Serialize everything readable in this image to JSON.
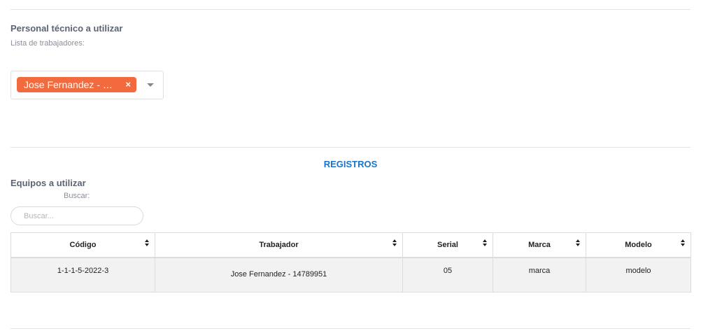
{
  "personal": {
    "title": "Personal técnico a utilizar",
    "list_label": "Lista de trabajadores:",
    "selected_chip": "Jose Fernandez - …",
    "chip_remove": "×"
  },
  "registros": {
    "heading": "REGISTROS"
  },
  "equipos": {
    "title": "Equipos a utilizar",
    "search_label": "Buscar:",
    "search_placeholder": "Buscar...",
    "search_value": ""
  },
  "table": {
    "headers": [
      "Código",
      "Trabajador",
      "Serial",
      "Marca",
      "Modelo"
    ],
    "rows": [
      [
        "1-1-1-5-2022-3",
        "Jose Fernandez - 14789951",
        "05",
        "marca",
        "modelo"
      ]
    ]
  },
  "colors": {
    "chip": "#f26a3d",
    "heading_accent": "#1a73c8",
    "row_bg": "#f2f2f2"
  }
}
